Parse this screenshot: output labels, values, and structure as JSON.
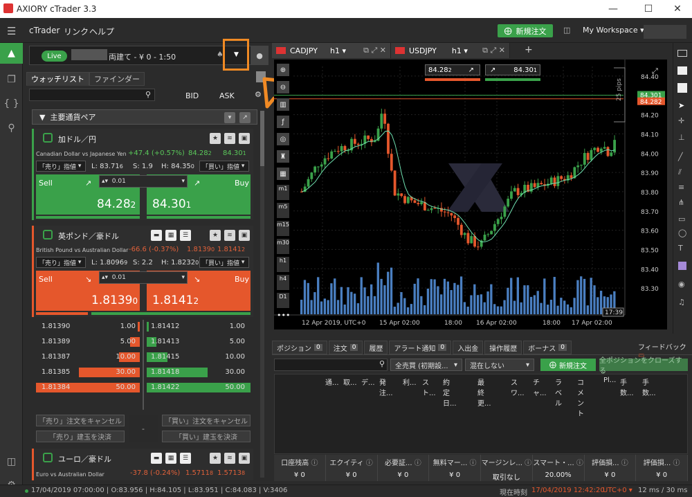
{
  "window": {
    "title": "AXIORY cTrader 3.3"
  },
  "menu": [
    "cTrader",
    "リンク",
    "ヘルプ"
  ],
  "header": {
    "new_order": "新規注文",
    "workspace": "My Workspace"
  },
  "account": {
    "live": "Live",
    "text": "両建て - ¥ 0 - 1:50"
  },
  "watchlist": {
    "tabs": [
      "ウォッチリスト",
      "ファインダー"
    ],
    "bid": "BID",
    "ask": "ASK",
    "group": "主要通貨ペア"
  },
  "symbols": [
    {
      "name": "加ドル／円",
      "desc": "Canadian Dollar vs Japanese Yen",
      "change": "+47.4 (+0.57%)",
      "bid_s": "84.28",
      "bid_sup": "2",
      "ask_s": "84.30",
      "ask_sup": "1",
      "type": "「売り」指値",
      "low_label": "L:",
      "low": "83.71",
      "low_sup": "6",
      "spread_label": "S:",
      "spread": "1.9",
      "high_label": "H:",
      "high": "84.35",
      "high_sup": "0",
      "type2": "「買い」指値",
      "sell": "Sell",
      "buy": "Buy",
      "qty": "0.01",
      "bid_big": "84.28",
      "bid_big_sup": "2",
      "ask_big": "84.30",
      "ask_big_sup": "1"
    },
    {
      "name": "英ポンド／豪ドル",
      "desc": "British Pound vs Australian Dollar",
      "change": "-66.6 (-0.37%)",
      "bid_s": "1.8139",
      "bid_sup": "0",
      "ask_s": "1.8141",
      "ask_sup": "2",
      "type": "「売り」指値",
      "low_label": "L:",
      "low": "1.8096",
      "low_sup": "9",
      "spread_label": "S:",
      "spread": "2.2",
      "high_label": "H:",
      "high": "1.8232",
      "high_sup": "0",
      "type2": "「買い」指値",
      "sell": "Sell",
      "buy": "Buy",
      "qty": "0.01",
      "bid_big": "1.8139",
      "bid_big_sup": "0",
      "ask_big": "1.8141",
      "ask_big_sup": "2"
    },
    {
      "name": "ユーロ／豪ドル",
      "desc": "Euro vs Australian Dollar",
      "change": "-37.8 (-0.24%)",
      "bid_s": "1.5711",
      "bid_sup": "8",
      "ask_s": "1.5713",
      "ask_sup": "8"
    }
  ],
  "orderbook": {
    "bids": [
      [
        "1.81390",
        "1.00"
      ],
      [
        "1.81389",
        "5.00"
      ],
      [
        "1.81387",
        "10.00"
      ],
      [
        "1.81385",
        "30.00"
      ],
      [
        "1.81384",
        "50.00"
      ]
    ],
    "asks": [
      [
        "1.81412",
        "1.00"
      ],
      [
        "1.81413",
        "5.00"
      ],
      [
        "1.81415",
        "10.00"
      ],
      [
        "1.81418",
        "30.00"
      ],
      [
        "1.81422",
        "50.00"
      ]
    ],
    "cancel_sell": "「売り」注文をキャンセル",
    "cancel_buy": "「買い」注文をキャンセル",
    "close_sell": "「売り」建玉を決済",
    "close_buy": "「買い」建玉を決済",
    "mid": "-"
  },
  "chart_tabs": [
    {
      "sym": "CADJPY",
      "tf": "h1"
    },
    {
      "sym": "USDJPY",
      "tf": "h1"
    }
  ],
  "chart": {
    "bid": "84.282",
    "ask": "84.301",
    "bid_label": "84.28",
    "bid_label_sup": "2",
    "ask_label": "84.30",
    "ask_label_sup": "1",
    "pips": "25 pips",
    "y_ticks": [
      "84.40",
      "84.30",
      "84.20",
      "84.10",
      "84.00",
      "83.90",
      "83.80",
      "83.70",
      "83.60",
      "83.50",
      "83.40",
      "83.30"
    ],
    "y_vals": [
      84.4,
      84.3,
      84.2,
      84.1,
      84.0,
      83.9,
      83.8,
      83.7,
      83.6,
      83.5,
      83.4,
      83.3
    ],
    "x_ticks": [
      "12 Apr 2019, UTC+0",
      "15 Apr 02:00",
      "18:00",
      "16 Apr 02:00",
      "18:00",
      "17 Apr 02:00"
    ],
    "timer": "17:39",
    "left_tools": [
      "m1",
      "m5",
      "m15",
      "m30",
      "h1",
      "h4",
      "D1"
    ]
  },
  "chart_data": {
    "type": "candlestick",
    "ylim": [
      83.25,
      84.45
    ],
    "last": 84.282,
    "ask": 84.301
  },
  "positions": {
    "tabs": [
      {
        "label": "ポジション",
        "n": "0"
      },
      {
        "label": "注文",
        "n": "0"
      },
      {
        "label": "履歴",
        "n": ""
      },
      {
        "label": "アラート通知",
        "n": "0"
      },
      {
        "label": "入出金",
        "n": ""
      },
      {
        "label": "操作履歴",
        "n": ""
      },
      {
        "label": "ボーナス",
        "n": "0"
      }
    ],
    "feedback": "フィードバック",
    "filter1": "全売買 (初期設...",
    "filter2": "混在しない",
    "new_order": "新規注文",
    "close_all": "全ポジションをクローズする",
    "columns": [
      "通...",
      "取...",
      "デ...",
      "発注...",
      "利...",
      "スト...",
      "約定日...",
      "最終更...",
      "スワ...",
      "チャ...",
      "ラベル",
      "コメント",
      "Pl...",
      "手数...",
      "手数..."
    ],
    "summary": [
      {
        "l": "口座残高",
        "v": "¥ 0"
      },
      {
        "l": "エクイティ",
        "v": "¥ 0"
      },
      {
        "l": "必要証...",
        "v": "¥ 0"
      },
      {
        "l": "無料マー...",
        "v": "¥ 0"
      },
      {
        "l": "マージンレ...",
        "v": "取引なし"
      },
      {
        "l": "スマート・...",
        "v": "20.00%"
      },
      {
        "l": "評価損...",
        "v": "¥ 0"
      },
      {
        "l": "評価損...",
        "v": "¥ 0"
      }
    ]
  },
  "status": {
    "ohlc": "17/04/2019 07:00:00 | O:83.956 | H:84.105 | L:83.951 | C:84.083 | V:3406",
    "now_label": "現在時刻",
    "now": "17/04/2019 12:42:20",
    "tz": "UTC+0",
    "ping": "12 ms / 30 ms"
  },
  "colors": {
    "green": "#3aa14a",
    "red": "#e5572c",
    "annotation": "#f08a24"
  }
}
